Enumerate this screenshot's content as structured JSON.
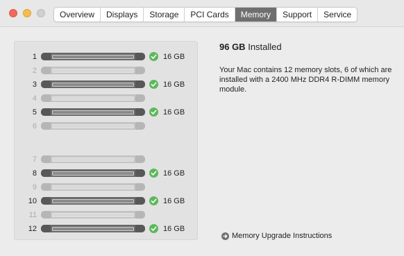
{
  "window": {
    "controls": [
      "close-button",
      "minimize-button",
      "zoom-button"
    ]
  },
  "tabs": [
    {
      "label": "Overview",
      "active": false
    },
    {
      "label": "Displays",
      "active": false
    },
    {
      "label": "Storage",
      "active": false
    },
    {
      "label": "PCI Cards",
      "active": false
    },
    {
      "label": "Memory",
      "active": true
    },
    {
      "label": "Support",
      "active": false
    },
    {
      "label": "Service",
      "active": false
    }
  ],
  "slots": [
    {
      "number": "1",
      "installed": true,
      "size": "16 GB"
    },
    {
      "number": "2",
      "installed": false,
      "size": ""
    },
    {
      "number": "3",
      "installed": true,
      "size": "16 GB"
    },
    {
      "number": "4",
      "installed": false,
      "size": ""
    },
    {
      "number": "5",
      "installed": true,
      "size": "16 GB"
    },
    {
      "number": "6",
      "installed": false,
      "size": ""
    },
    {
      "number": "7",
      "installed": false,
      "size": ""
    },
    {
      "number": "8",
      "installed": true,
      "size": "16 GB"
    },
    {
      "number": "9",
      "installed": false,
      "size": ""
    },
    {
      "number": "10",
      "installed": true,
      "size": "16 GB"
    },
    {
      "number": "11",
      "installed": false,
      "size": ""
    },
    {
      "number": "12",
      "installed": true,
      "size": "16 GB"
    }
  ],
  "summary": {
    "total": "96 GB",
    "installed_label": "Installed",
    "description": "Your Mac contains 12 memory slots, 6 of which are installed with a 2400 MHz DDR4 R-DIMM memory module."
  },
  "upgrade_link": {
    "label": "Memory Upgrade Instructions",
    "icon": "arrow-circle-icon"
  },
  "colors": {
    "active_tab": "#6f6f6f",
    "check_green": "#5cb85c",
    "dimm_installed": "#6a6a6a",
    "dimm_empty": "#c4c4c4"
  }
}
